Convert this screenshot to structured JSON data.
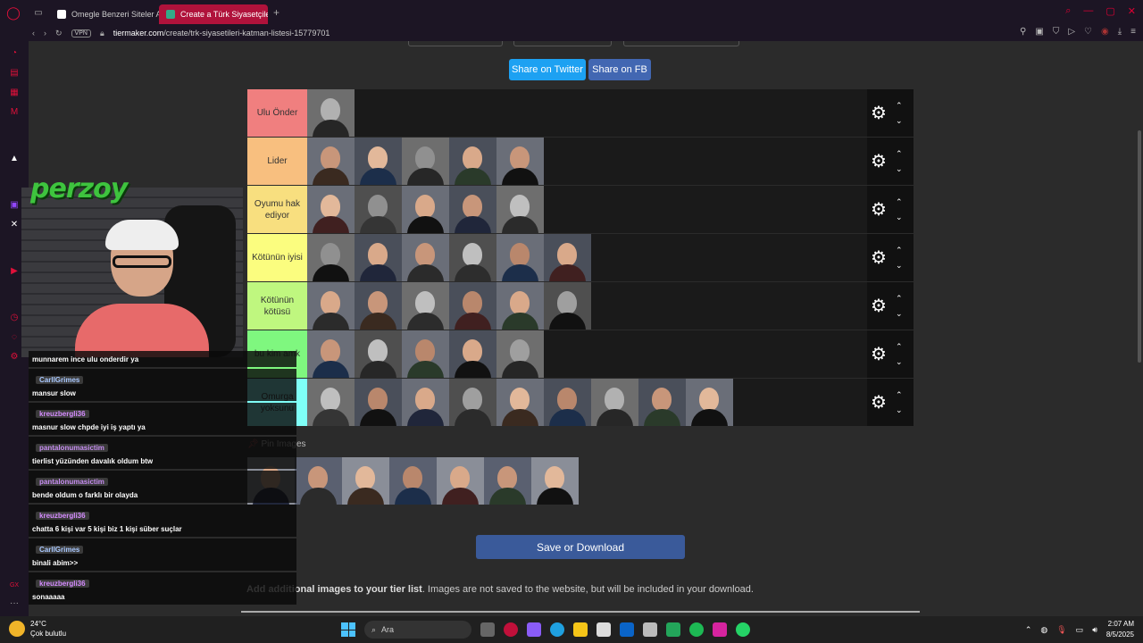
{
  "browser": {
    "tabs": [
      {
        "title": "Omegle Benzeri Siteler Ar",
        "active": false
      },
      {
        "title": "Create a Türk Siyasetçiler",
        "active": true
      }
    ],
    "url_host": "tiermaker.com",
    "url_path": "/create/trk-siyasetileri-katman-listesi-15779701",
    "vpn_label": "VPN"
  },
  "share": {
    "twitter": "Share on Twitter",
    "facebook": "Share on FB"
  },
  "tiers": [
    {
      "label": "Ulu Önder",
      "color": "#f07f7f",
      "count": 1
    },
    {
      "label": "Lider",
      "color": "#f8bf7f",
      "count": 5
    },
    {
      "label": "Oyumu hak ediyor",
      "color": "#f8df7f",
      "count": 5
    },
    {
      "label": "Kötünün iyisi",
      "color": "#fbfd7f",
      "count": 6
    },
    {
      "label": "Kötünün kötüsü",
      "color": "#bff77f",
      "count": 6
    },
    {
      "label": "bu kim amk",
      "color": "#7ff77f",
      "count": 5
    },
    {
      "label": "Omurga yoksunu",
      "color": "#7ffff7",
      "count": 9
    }
  ],
  "pin_label": "Pin Images",
  "pool_count": 7,
  "save_button": "Save or Download",
  "add_images": {
    "bold": "Add additional images to your tier list",
    "rest": ". Images are not saved to the website, but will be included in your download."
  },
  "stream": {
    "logo": "perzoy",
    "chat": [
      {
        "user": "",
        "text": "munnarem ince ulu onderdir ya"
      },
      {
        "user": "CarllGrimes",
        "text": "mansur slow"
      },
      {
        "user": "kreuzbergli36",
        "text": "masnur slow chpde iyi iş yaptı ya"
      },
      {
        "user": "pantalonumasictim",
        "text": "tierlist yüzünden davalık oldum btw"
      },
      {
        "user": "pantalonumasictim",
        "text": "bende oldum o farklı bir olayda"
      },
      {
        "user": "kreuzbergli36",
        "text": "chatta 6 kişi var 5 kişi biz 1 kişi süber suçlar"
      },
      {
        "user": "CarllGrimes",
        "text": "binali abim>>"
      },
      {
        "user": "kreuzbergli36",
        "text": "sonaaaaa"
      }
    ]
  },
  "taskbar": {
    "weather_temp": "24°C",
    "weather_desc": "Çok bulutlu",
    "search_placeholder": "Ara",
    "time": "2:07 AM",
    "date": "8/5/2025"
  }
}
